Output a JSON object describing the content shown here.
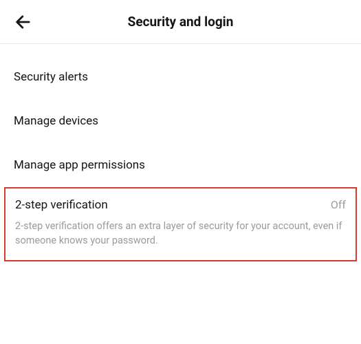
{
  "header": {
    "title": "Security and login"
  },
  "items": {
    "security_alerts": "Security alerts",
    "manage_devices": "Manage devices",
    "manage_app_permissions": "Manage app permissions"
  },
  "two_step": {
    "title": "2-step verification",
    "status": "Off",
    "description": "2-step verification offers an extra layer of security for your account, even if someone knows your password."
  }
}
